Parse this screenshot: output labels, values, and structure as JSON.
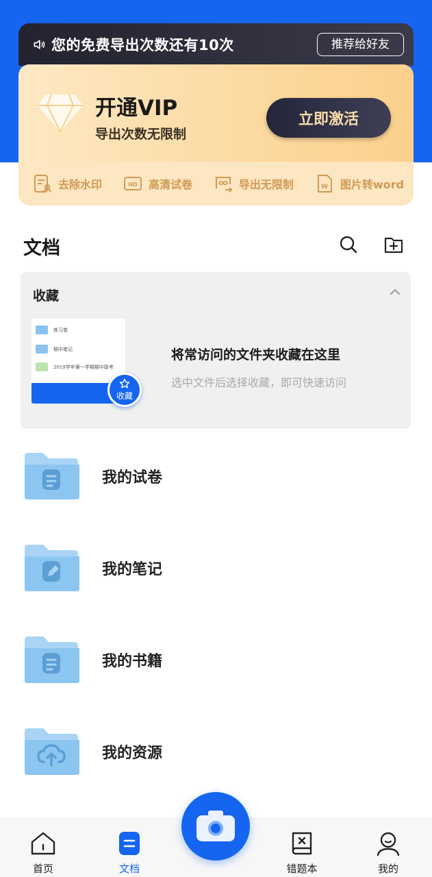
{
  "notice": {
    "text": "您的免费导出次数还有10次",
    "recommend_label": "推荐给好友"
  },
  "vip": {
    "title": "开通VIP",
    "subtitle": "导出次数无限制",
    "activate_label": "立即激活",
    "features": [
      {
        "label": "去除水印",
        "icon": "watermark-icon"
      },
      {
        "label": "高清试卷",
        "icon": "hd-icon"
      },
      {
        "label": "导出无限制",
        "icon": "infinite-export-icon"
      },
      {
        "label": "图片转word",
        "icon": "word-icon"
      }
    ]
  },
  "documents": {
    "title": "文档",
    "favorites": {
      "title": "收藏",
      "main_text": "将常访问的文件夹收藏在这里",
      "hint_text": "选中文件后选择收藏，即可快速访问",
      "badge_label": "收藏",
      "thumb_rows": [
        "练习卷",
        "期中笔记",
        "2019学年第一学期期中联考"
      ]
    },
    "folders": [
      {
        "label": "我的试卷",
        "icon": "exam-folder-icon"
      },
      {
        "label": "我的笔记",
        "icon": "notes-folder-icon"
      },
      {
        "label": "我的书籍",
        "icon": "books-folder-icon"
      },
      {
        "label": "我的资源",
        "icon": "cloud-upload-folder-icon"
      }
    ]
  },
  "nav": {
    "items": [
      {
        "label": "首页",
        "icon": "home-icon"
      },
      {
        "label": "文档",
        "icon": "document-icon"
      },
      {
        "label": "错题本",
        "icon": "mistake-book-icon"
      },
      {
        "label": "我的",
        "icon": "profile-icon"
      }
    ],
    "active": "文档"
  },
  "colors": {
    "primary": "#1565f0",
    "vip_gold": "#cf9a52",
    "folder_blue": "#8cc2ee"
  }
}
